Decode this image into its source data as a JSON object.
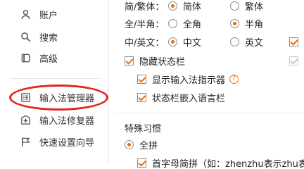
{
  "sidebar": {
    "items": [
      {
        "label": "账户",
        "icon": "user-icon"
      },
      {
        "label": "搜索",
        "icon": "search-icon"
      },
      {
        "label": "高级",
        "icon": "square-icon"
      },
      {
        "label": "输入法管理器",
        "icon": "list-icon"
      },
      {
        "label": "输入法修复器",
        "icon": "repair-icon"
      },
      {
        "label": "快速设置向导",
        "icon": "flag-icon"
      }
    ]
  },
  "settings": {
    "simp_trad": {
      "label": "简/繁体：",
      "opt1": "简体",
      "opt2": "繁体"
    },
    "full_half": {
      "label": "全/半角：",
      "opt1": "全角",
      "opt2": "半角"
    },
    "cn_en": {
      "label": "中/英文：",
      "opt1": "中文",
      "opt2": "英文"
    },
    "hide_status_bar": "隐藏状态栏",
    "show_indicator": "显示输入法指示器",
    "help_glyph": "?",
    "embed_lang_bar": "状态栏嵌入语言栏",
    "special_habits": "特殊习惯",
    "full_pinyin": "全拼",
    "partial_line": "首字母简拼（如：zhenzhu表示zhu表示"
  },
  "colors": {
    "accent": "#ef6c00",
    "highlight_ring": "#e0241f"
  }
}
